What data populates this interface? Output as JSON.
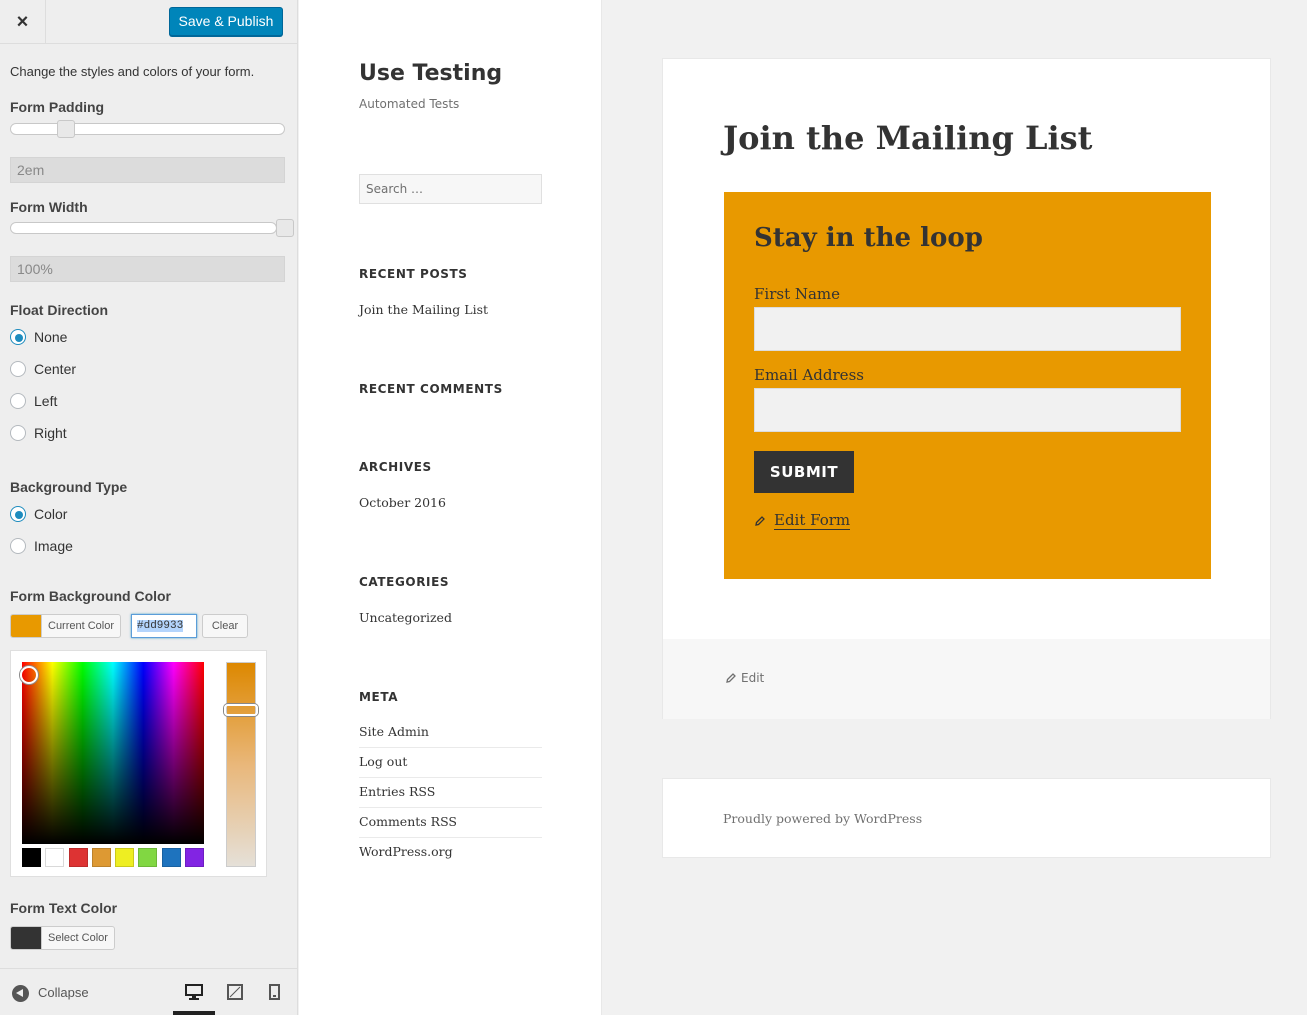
{
  "header": {
    "close_label": "×",
    "publish_label": "Save & Publish"
  },
  "section": {
    "description": "Change the styles and colors of your form.",
    "form_padding": {
      "title": "Form Padding",
      "value": "2em",
      "slider_fraction": 0.2
    },
    "form_width": {
      "title": "Form Width",
      "value": "100%",
      "slider_fraction": 1.0
    },
    "float_direction": {
      "title": "Float Direction",
      "options": [
        "None",
        "Center",
        "Left",
        "Right"
      ],
      "selected": "None"
    },
    "background_type": {
      "title": "Background Type",
      "options": [
        "Color",
        "Image"
      ],
      "selected": "Color"
    },
    "form_background_color": {
      "title": "Form Background Color",
      "button_label": "Current Color",
      "hex_value": "#dd9933",
      "clear_label": "Clear",
      "palette": [
        "#000000",
        "#ffffff",
        "#dd3333",
        "#dd9933",
        "#eeee22",
        "#81d742",
        "#1e73be",
        "#8224e3"
      ]
    },
    "form_text_color": {
      "title": "Form Text Color",
      "button_label": "Select Color",
      "swatch": "#333333"
    }
  },
  "footer": {
    "collapse_label": "Collapse",
    "devices": [
      "desktop-icon",
      "tablet-icon",
      "mobile-icon"
    ],
    "active_device": "desktop-icon"
  },
  "site": {
    "title": "Use Testing",
    "description": "Automated Tests",
    "search_placeholder": "Search …",
    "widgets": {
      "recent_posts": {
        "title": "RECENT POSTS",
        "items": [
          "Join the Mailing List"
        ]
      },
      "recent_comments": {
        "title": "RECENT COMMENTS"
      },
      "archives": {
        "title": "ARCHIVES",
        "items": [
          "October 2016"
        ]
      },
      "categories": {
        "title": "CATEGORIES",
        "items": [
          "Uncategorized"
        ]
      },
      "meta": {
        "title": "META",
        "items": [
          "Site Admin",
          "Log out",
          "Entries RSS",
          "Comments RSS",
          "WordPress.org"
        ]
      }
    }
  },
  "article": {
    "title": "Join the Mailing List",
    "form": {
      "heading": "Stay in the loop",
      "background": "#e89900",
      "fields": [
        {
          "label": "First Name",
          "value": ""
        },
        {
          "label": "Email Address",
          "value": ""
        }
      ],
      "submit_label": "SUBMIT",
      "edit_form_label": "Edit Form"
    },
    "edit_label": "Edit"
  },
  "site_footer": {
    "text": "Proudly powered by WordPress"
  },
  "colors": {
    "accent": "#0085ba",
    "radio_selected": "#1e8cbe"
  }
}
